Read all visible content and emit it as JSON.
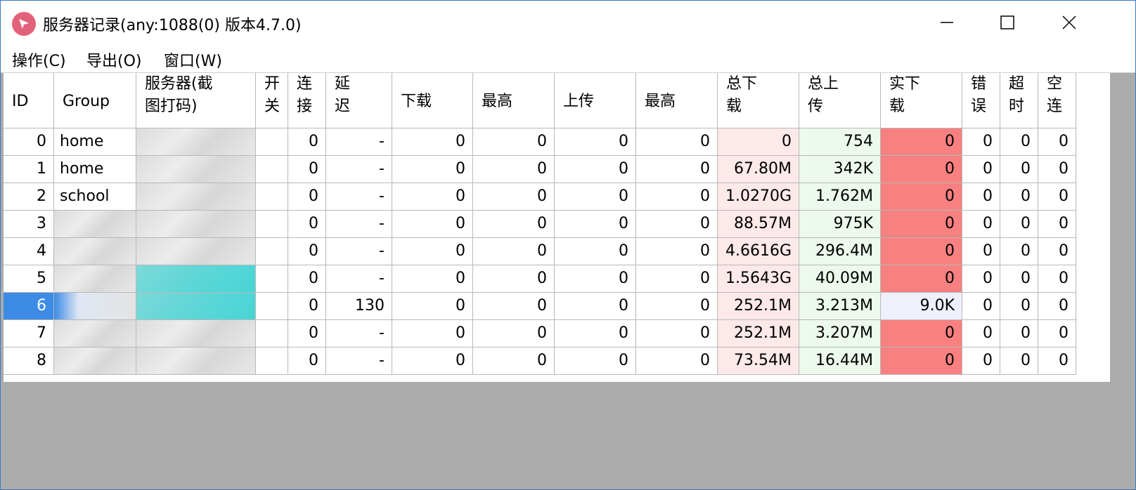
{
  "window": {
    "title": "服务器记录(any:1088(0) 版本4.7.0)",
    "icon": "cursor-arrow-icon",
    "controls": [
      "minimize-icon",
      "maximize-icon",
      "close-icon"
    ]
  },
  "menu": [
    "操作(C)",
    "导出(O)",
    "窗口(W)"
  ],
  "table": {
    "headers": [
      {
        "l1": "ID",
        "l2": ""
      },
      {
        "l1": "Group",
        "l2": ""
      },
      {
        "l1": "服务器(截",
        "l2": "图打码)"
      },
      {
        "l1": "开",
        "l2": "关"
      },
      {
        "l1": "连",
        "l2": "接"
      },
      {
        "l1": "延",
        "l2": "迟"
      },
      {
        "l1": "下载",
        "l2": ""
      },
      {
        "l1": "最高",
        "l2": ""
      },
      {
        "l1": "上传",
        "l2": ""
      },
      {
        "l1": "最高",
        "l2": ""
      },
      {
        "l1": "总下",
        "l2": "载"
      },
      {
        "l1": "总上",
        "l2": "传"
      },
      {
        "l1": "实下",
        "l2": "载"
      },
      {
        "l1": "错",
        "l2": "误"
      },
      {
        "l1": "超",
        "l2": "时"
      },
      {
        "l1": "空",
        "l2": "连"
      }
    ],
    "rows": [
      {
        "id": "0",
        "group": "home",
        "connect": "0",
        "latency": "-",
        "down": "0",
        "down_max": "0",
        "up": "0",
        "up_max": "0",
        "total_down": "0",
        "total_up": "754",
        "real_down": "0",
        "error": "0",
        "timeout": "0",
        "idle": "0",
        "selected": false,
        "real_ok": false
      },
      {
        "id": "1",
        "group": "home",
        "connect": "0",
        "latency": "-",
        "down": "0",
        "down_max": "0",
        "up": "0",
        "up_max": "0",
        "total_down": "67.80M",
        "total_up": "342K",
        "real_down": "0",
        "error": "0",
        "timeout": "0",
        "idle": "0",
        "selected": false,
        "real_ok": false
      },
      {
        "id": "2",
        "group": "school",
        "connect": "0",
        "latency": "-",
        "down": "0",
        "down_max": "0",
        "up": "0",
        "up_max": "0",
        "total_down": "1.0270G",
        "total_up": "1.762M",
        "real_down": "0",
        "error": "0",
        "timeout": "0",
        "idle": "0",
        "selected": false,
        "real_ok": false
      },
      {
        "id": "3",
        "group": "",
        "connect": "0",
        "latency": "-",
        "down": "0",
        "down_max": "0",
        "up": "0",
        "up_max": "0",
        "total_down": "88.57M",
        "total_up": "975K",
        "real_down": "0",
        "error": "0",
        "timeout": "0",
        "idle": "0",
        "selected": false,
        "real_ok": false
      },
      {
        "id": "4",
        "group": "",
        "connect": "0",
        "latency": "-",
        "down": "0",
        "down_max": "0",
        "up": "0",
        "up_max": "0",
        "total_down": "4.6616G",
        "total_up": "296.4M",
        "real_down": "0",
        "error": "0",
        "timeout": "0",
        "idle": "0",
        "selected": false,
        "real_ok": false
      },
      {
        "id": "5",
        "group": "",
        "connect": "0",
        "latency": "-",
        "down": "0",
        "down_max": "0",
        "up": "0",
        "up_max": "0",
        "total_down": "1.5643G",
        "total_up": "40.09M",
        "real_down": "0",
        "error": "0",
        "timeout": "0",
        "idle": "0",
        "selected": false,
        "real_ok": false
      },
      {
        "id": "6",
        "group": "",
        "connect": "0",
        "latency": "130",
        "down": "0",
        "down_max": "0",
        "up": "0",
        "up_max": "0",
        "total_down": "252.1M",
        "total_up": "3.213M",
        "real_down": "9.0K",
        "error": "0",
        "timeout": "0",
        "idle": "0",
        "selected": true,
        "real_ok": true
      },
      {
        "id": "7",
        "group": "",
        "connect": "0",
        "latency": "-",
        "down": "0",
        "down_max": "0",
        "up": "0",
        "up_max": "0",
        "total_down": "252.1M",
        "total_up": "3.207M",
        "real_down": "0",
        "error": "0",
        "timeout": "0",
        "idle": "0",
        "selected": false,
        "real_ok": false
      },
      {
        "id": "8",
        "group": "",
        "connect": "0",
        "latency": "-",
        "down": "0",
        "down_max": "0",
        "up": "0",
        "up_max": "0",
        "total_down": "73.54M",
        "total_up": "16.44M",
        "real_down": "0",
        "error": "0",
        "timeout": "0",
        "idle": "0",
        "selected": false,
        "real_ok": false
      }
    ]
  },
  "colors": {
    "selection": "#3c8be5",
    "total_down_bg": "#fde9e9",
    "total_up_bg": "#ecf9ec",
    "real_down_zero_bg": "#f88080",
    "real_down_active_bg": "#eef0fb",
    "empty_area": "#ababab"
  }
}
